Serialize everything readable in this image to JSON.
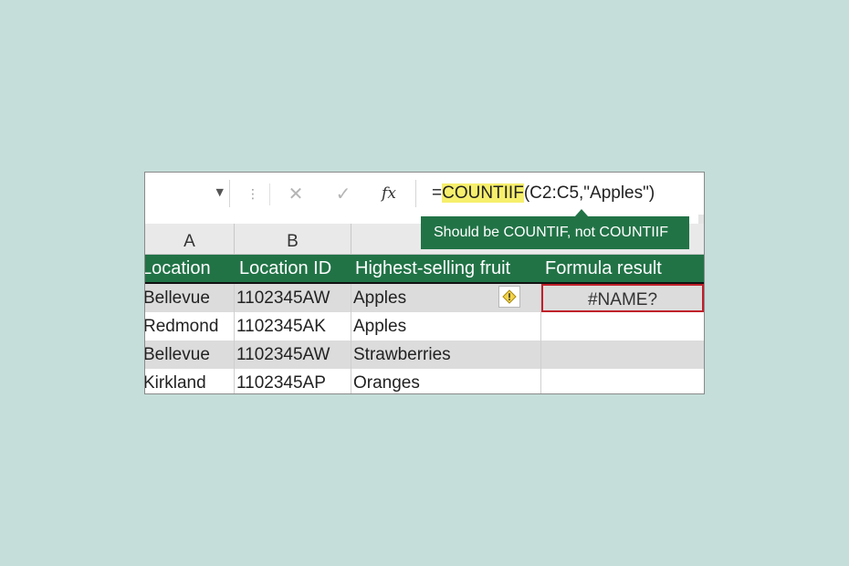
{
  "formula_bar": {
    "dots": "⋮",
    "cancel": "✕",
    "enter": "✓",
    "fx": "fx",
    "formula_prefix": "=",
    "formula_fn": "COUNTIIF",
    "formula_args": "(C2:C5,\"Apples\")"
  },
  "tooltip": {
    "text": "Should be COUNTIF, not COUNTIIF"
  },
  "column_letters": [
    "A",
    "B"
  ],
  "table": {
    "headers": [
      "Location",
      "Location ID",
      "Highest-selling fruit",
      "Formula result"
    ],
    "rows": [
      [
        "Bellevue",
        "1102345AW",
        "Apples",
        "#NAME?"
      ],
      [
        "Redmond",
        "1102345AK",
        "Apples",
        ""
      ],
      [
        "Bellevue",
        "1102345AW",
        "Strawberries",
        ""
      ],
      [
        "Kirkland",
        "1102345AP",
        "Oranges",
        ""
      ]
    ]
  },
  "colors": {
    "background": "#c5deda",
    "excel_green": "#217346",
    "error_border": "#c0202a",
    "highlight": "#f6ef6c"
  },
  "icons": {
    "warning": "warning-diamond-icon",
    "cancel": "close-icon",
    "enter": "check-icon"
  }
}
